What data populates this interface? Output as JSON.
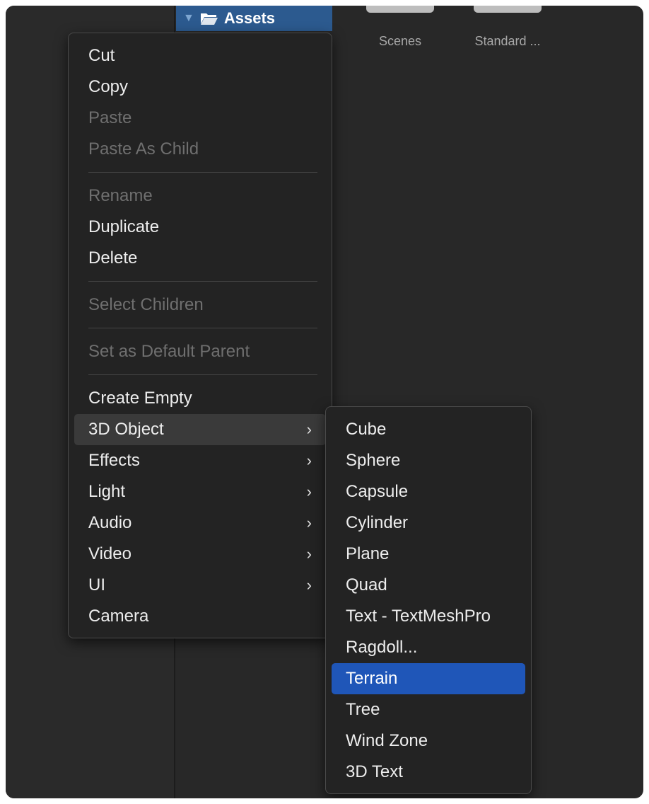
{
  "project": {
    "folder_label": "Assets",
    "thumbnails": [
      {
        "label": "Scenes"
      },
      {
        "label": "Standard ..."
      }
    ]
  },
  "context_menu": {
    "cut": "Cut",
    "copy": "Copy",
    "paste": "Paste",
    "paste_as_child": "Paste As Child",
    "rename": "Rename",
    "duplicate": "Duplicate",
    "delete": "Delete",
    "select_children": "Select Children",
    "set_default_parent": "Set as Default Parent",
    "create_empty": "Create Empty",
    "object_3d": "3D Object",
    "effects": "Effects",
    "light": "Light",
    "audio": "Audio",
    "video": "Video",
    "ui": "UI",
    "camera": "Camera",
    "chevron": "›"
  },
  "submenu_3d_object": {
    "items": [
      "Cube",
      "Sphere",
      "Capsule",
      "Cylinder",
      "Plane",
      "Quad",
      "Text - TextMeshPro",
      "Ragdoll...",
      "Terrain",
      "Tree",
      "Wind Zone",
      "3D Text"
    ],
    "selected": "Terrain"
  },
  "colors": {
    "window_bg": "#282828",
    "menu_bg": "#232323",
    "selection": "#1f56b8",
    "folder_row": "#2c5a8f",
    "disabled_text": "#6f6f6f"
  }
}
